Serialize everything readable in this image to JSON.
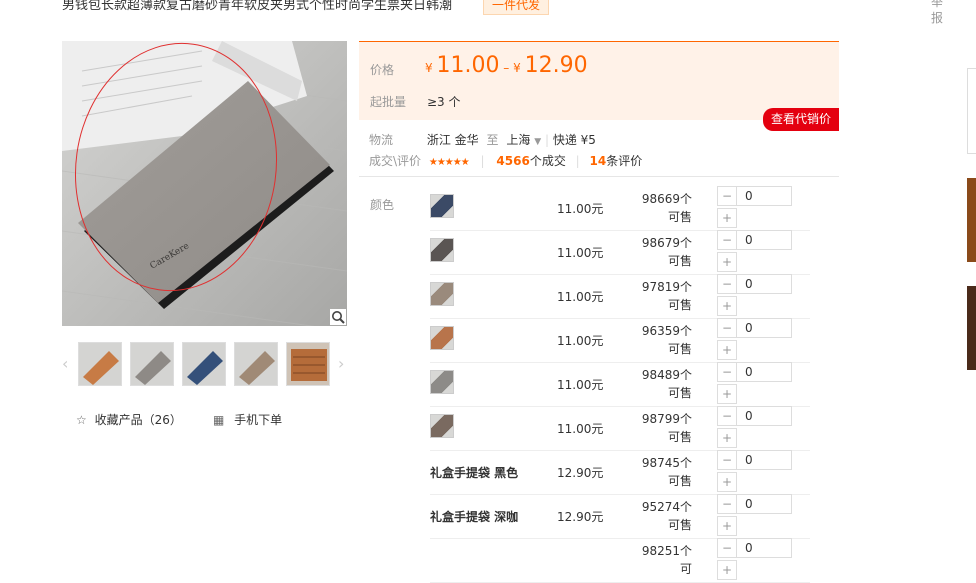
{
  "title": "男钱包长款超薄款复古磨砂青年软皮夹男式个性时尚学生票夹日韩潮",
  "tag": "一件代发",
  "side_chars": [
    "举",
    "报"
  ],
  "price": {
    "label": "价格",
    "currency": "¥",
    "low": "11.00",
    "dash": "–",
    "high": "12.90"
  },
  "moq": {
    "label": "起批量",
    "value": "≥3 个"
  },
  "agent_button": "查看代销价",
  "logistics": {
    "label": "物流",
    "from": "浙江 金华",
    "to_word": "至",
    "dest": "上海",
    "shipping": "快递 ¥5"
  },
  "deal": {
    "label": "成交\\评价",
    "stars": "★★★★★",
    "count": "4566",
    "count_suffix": "个成交",
    "reviews": "14",
    "reviews_suffix": "条评价"
  },
  "color_label": "颜色",
  "variants": [
    {
      "swatch": "#3b4a66",
      "price": "11.00元",
      "stock": "98669个可售",
      "qty": "0"
    },
    {
      "swatch": "#5a5553",
      "price": "11.00元",
      "stock": "98679个可售",
      "qty": "0"
    },
    {
      "swatch": "#9a8a7c",
      "price": "11.00元",
      "stock": "97819个可售",
      "qty": "0"
    },
    {
      "swatch": "#b8744b",
      "price": "11.00元",
      "stock": "96359个可售",
      "qty": "0"
    },
    {
      "swatch": "#8d8b88",
      "price": "11.00元",
      "stock": "98489个可售",
      "qty": "0"
    },
    {
      "swatch": "#7a6a60",
      "price": "11.00元",
      "stock": "98799个可售",
      "qty": "0"
    },
    {
      "name": "礼盒手提袋 黑色",
      "price": "12.90元",
      "stock": "98745个可售",
      "qty": "0"
    },
    {
      "name": "礼盒手提袋 深咖",
      "price": "12.90元",
      "stock": "95274个可售",
      "qty": "0"
    },
    {
      "stock": "98251个可",
      "qty": "0"
    }
  ],
  "thumbs": [
    "#c77b45",
    "#8e8a86",
    "#34507a",
    "#a08a76",
    "#b56c3a"
  ],
  "favorite": {
    "label": "收藏产品（26）"
  },
  "mobile": {
    "label": "手机下单"
  }
}
